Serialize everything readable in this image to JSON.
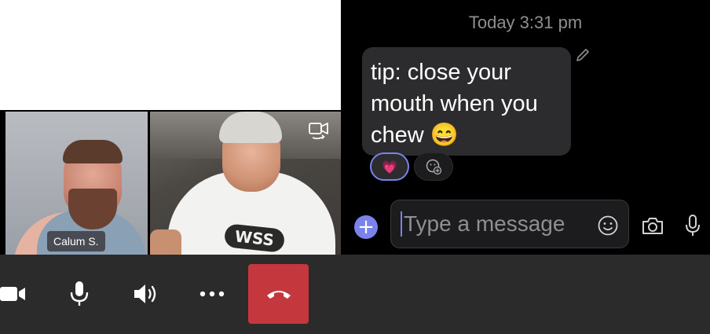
{
  "chat": {
    "timestamp": "Today 3:31 pm",
    "message": "tip: close your mouth when you chew 😄",
    "reactions": [
      {
        "emoji": "💗",
        "selected": true
      },
      {
        "icon": "add-reaction-icon"
      }
    ]
  },
  "composer": {
    "placeholder": "Type a message",
    "icons": [
      "plus-icon",
      "emoji-icon",
      "camera-icon",
      "microphone-icon"
    ]
  },
  "video": {
    "participant_name": "Calum S.",
    "shirt_logo": "WSS"
  },
  "controls": {
    "icons": [
      "video-camera-icon",
      "microphone-icon",
      "speaker-icon",
      "more-icon",
      "hang-up-icon"
    ]
  },
  "colors": {
    "accent": "#7b83eb",
    "hangup": "#c4383d",
    "bubble": "#2c2c2e",
    "control_bar": "#2b2b2b"
  }
}
